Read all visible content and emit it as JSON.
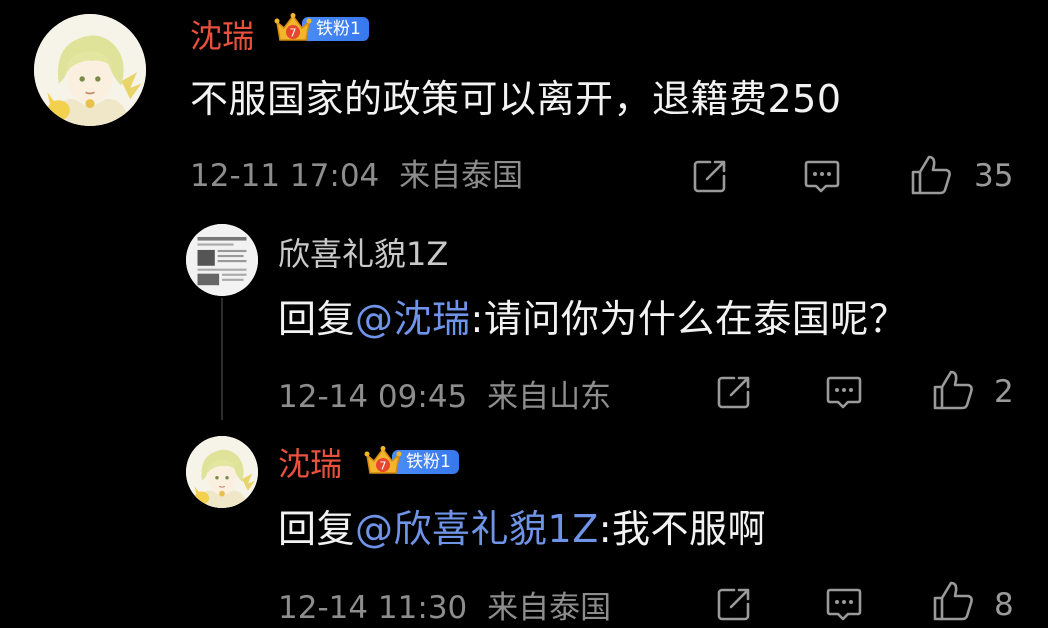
{
  "comments": [
    {
      "username": "沈瑞",
      "badge": "铁粉1",
      "badge_level": "7",
      "text": "不服国家的政策可以离开，退籍费250",
      "time": "12-11 17:04",
      "location": "来自泰国",
      "likes": "35",
      "icons": {
        "share": "share-icon",
        "reply": "comment-icon",
        "like": "thumbs-up-icon"
      }
    },
    {
      "username": "欣喜礼貌1Z",
      "reply_prefix": "回复",
      "mention": "@沈瑞",
      "text": ":请问你为什么在泰国呢？",
      "time": "12-14 09:45",
      "location": "来自山东",
      "likes": "2"
    },
    {
      "username": "沈瑞",
      "badge": "铁粉1",
      "badge_level": "7",
      "reply_prefix": "回复",
      "mention": "@欣喜礼貌1Z",
      "text": ":我不服啊",
      "time": "12-14 11:30",
      "location": "来自泰国",
      "likes": "8"
    }
  ],
  "colors": {
    "background": "#000000",
    "vip_name": "#e8513c",
    "mention": "#6f93e6",
    "badge": "#3f83f2",
    "meta": "#8d8d8d"
  }
}
